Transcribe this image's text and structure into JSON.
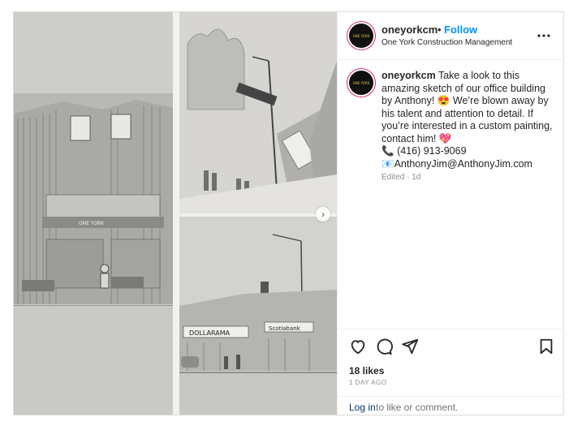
{
  "post": {
    "header": {
      "username": "oneyorkcm",
      "separator": "•",
      "follow_label": "Follow",
      "subtitle": "One York Construction Management",
      "more_icon": "more-horizontal-icon",
      "avatar_logo_text": "ONE YORK"
    },
    "caption": {
      "username": "oneyorkcm",
      "line1": "Take a look to this amazing sketch of our office building by Anthony!",
      "emoji1": "😍",
      "line2": "We’re blown away by his talent and attention to detail. If you’re interested in a custom painting, contact him!",
      "emoji2": "💖",
      "phone_icon": "📞",
      "phone": "(416) 913-9069",
      "email_icon": "📧",
      "email": "AnthonyJim@AnthonyJim.com",
      "edited": "Edited · 1d"
    },
    "media": {
      "next_icon": "chevron-right-icon",
      "next_glyph": "›",
      "sign1": "ONE YORK",
      "sign2": "DOLLARAMA",
      "sign3": "Scotiabank"
    },
    "actions": {
      "like_icon": "heart-icon",
      "comment_icon": "comment-icon",
      "share_icon": "share-icon",
      "save_icon": "bookmark-icon"
    },
    "likes": "18 likes",
    "timestamp": "1 DAY AGO",
    "login": {
      "link_label": "Log in",
      "rest": "to like or comment."
    }
  }
}
